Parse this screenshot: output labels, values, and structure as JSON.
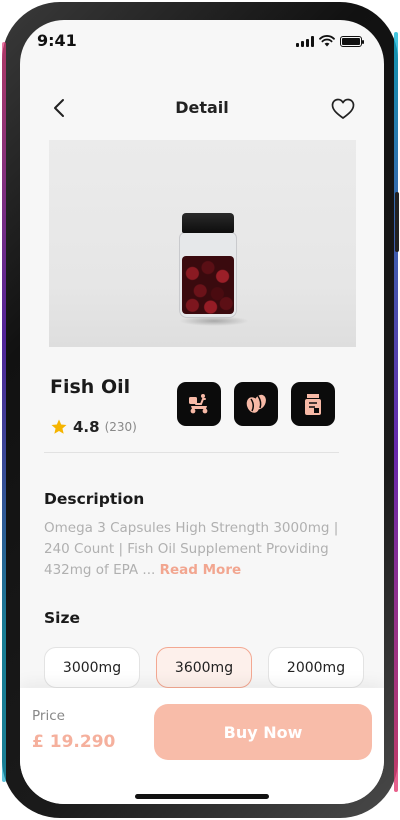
{
  "status_bar": {
    "time": "9:41",
    "icons": [
      "signal-icon",
      "wifi-icon",
      "battery-icon"
    ]
  },
  "header": {
    "title": "Detail",
    "back_icon": "chevron-left-icon",
    "favorite_icon": "heart-outline-icon"
  },
  "product": {
    "name": "Fish Oil",
    "rating": "4.8",
    "rating_count": "(230)",
    "image": "fish-oil-capsule-jar",
    "features": [
      {
        "icon": "delivery-scooter-icon"
      },
      {
        "icon": "coffee-bean-icon"
      },
      {
        "icon": "package-box-icon"
      }
    ]
  },
  "description": {
    "title": "Description",
    "text": "Omega 3 Capsules High Strength 3000mg | 240 Count | Fish Oil Supplement Providing 432mg of EPA ... ",
    "read_more": "Read More"
  },
  "size": {
    "title": "Size",
    "options": [
      "3000mg",
      "3600mg",
      "2000mg"
    ],
    "selected": "3600mg"
  },
  "checkout": {
    "price_label": "Price",
    "price": "£ 19.290",
    "buy_label": "Buy Now"
  },
  "colors": {
    "accent": "#f8bca9",
    "accent_text": "#f2a690",
    "selected_chip_bg": "#fdf0eb",
    "selected_chip_border": "#f3a892",
    "tile_bg": "#0b0b0b",
    "star": "#f5b400"
  }
}
